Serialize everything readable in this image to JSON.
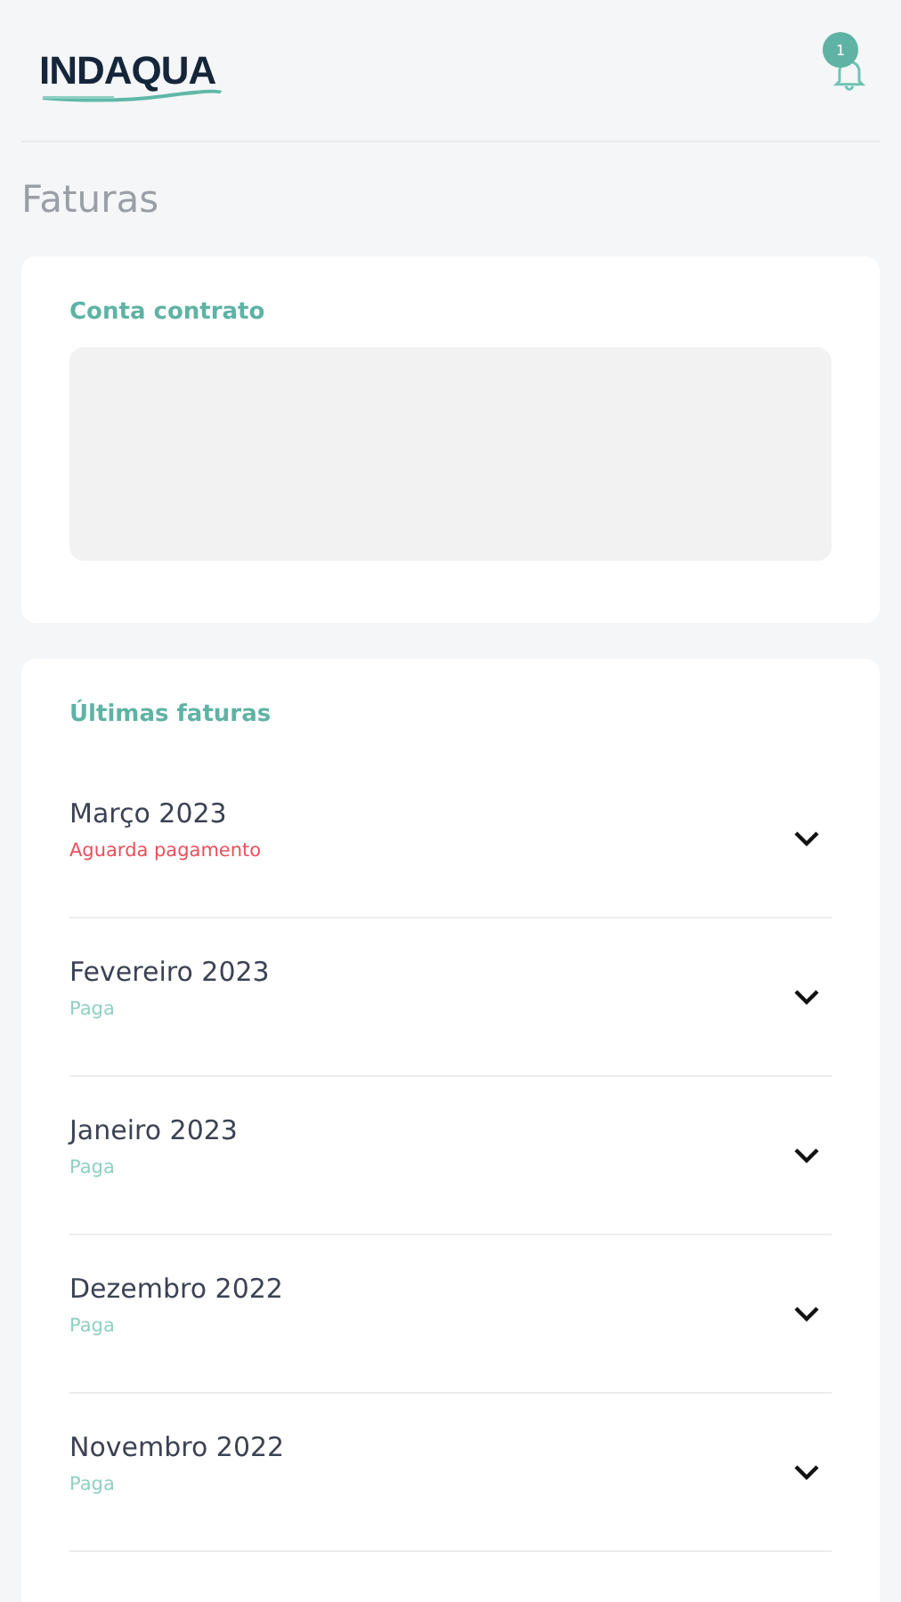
{
  "header": {
    "logo": "INDAQUA",
    "notification_count": "1"
  },
  "title": "Faturas",
  "contract": {
    "label": "Conta contrato"
  },
  "invoices": {
    "title": "Últimas faturas",
    "items": [
      {
        "month": "Março 2023",
        "status": "Aguarda pagamento",
        "kind": "pending",
        "expanded": false
      },
      {
        "month": "Fevereiro 2023",
        "status": "Paga",
        "kind": "paid",
        "expanded": false
      },
      {
        "month": "Janeiro 2023",
        "status": "Paga",
        "kind": "paid",
        "expanded": false
      },
      {
        "month": "Dezembro 2022",
        "status": "Paga",
        "kind": "paid",
        "expanded": false
      },
      {
        "month": "Novembro 2022",
        "status": "Paga",
        "kind": "paid",
        "expanded": false
      }
    ]
  }
}
